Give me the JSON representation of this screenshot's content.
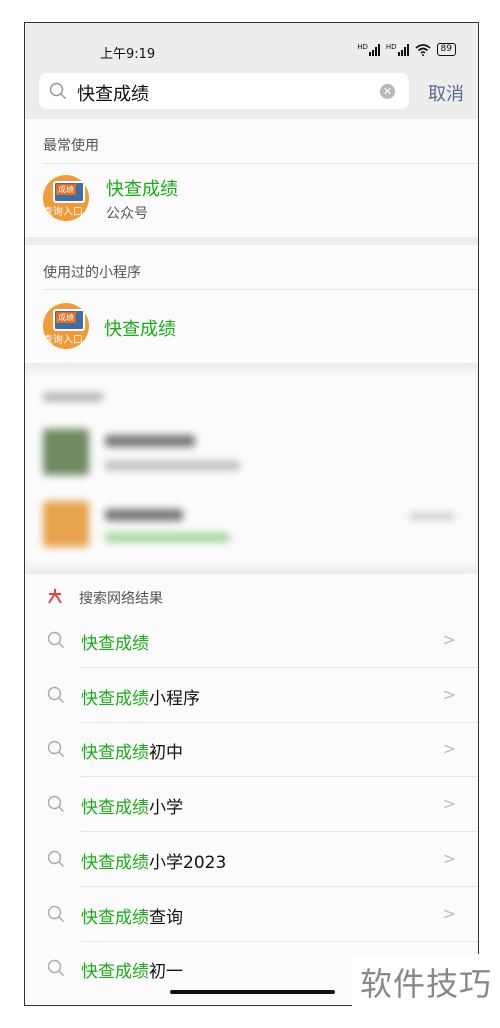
{
  "status_bar": {
    "time": "上午9:19",
    "net1": "HD",
    "net2": "HD",
    "battery": "89"
  },
  "search": {
    "query": "快查成绩",
    "cancel": "取消"
  },
  "most_used": {
    "title": "最常使用",
    "item": {
      "name": "快查成绩",
      "type": "公众号",
      "avatar_tag": "成绩",
      "avatar_text": "查询入口"
    }
  },
  "mini_programs": {
    "title": "使用过的小程序",
    "item": {
      "name": "快查成绩",
      "avatar_tag": "成绩",
      "avatar_text": "查询入口"
    }
  },
  "web_results": {
    "title": "搜索网络结果",
    "items": [
      {
        "highlight": "快查成绩",
        "suffix": ""
      },
      {
        "highlight": "快查成绩",
        "suffix": "小程序"
      },
      {
        "highlight": "快查成绩",
        "suffix": "初中"
      },
      {
        "highlight": "快查成绩",
        "suffix": "小学"
      },
      {
        "highlight": "快查成绩",
        "suffix": "小学2023"
      },
      {
        "highlight": "快查成绩",
        "suffix": "查询"
      },
      {
        "highlight": "快查成绩",
        "suffix": "初一"
      }
    ]
  },
  "watermark": "软件技巧",
  "colors": {
    "accent_green": "#1aad19",
    "link_blue": "#576b95",
    "icon_red": "#e64340"
  }
}
